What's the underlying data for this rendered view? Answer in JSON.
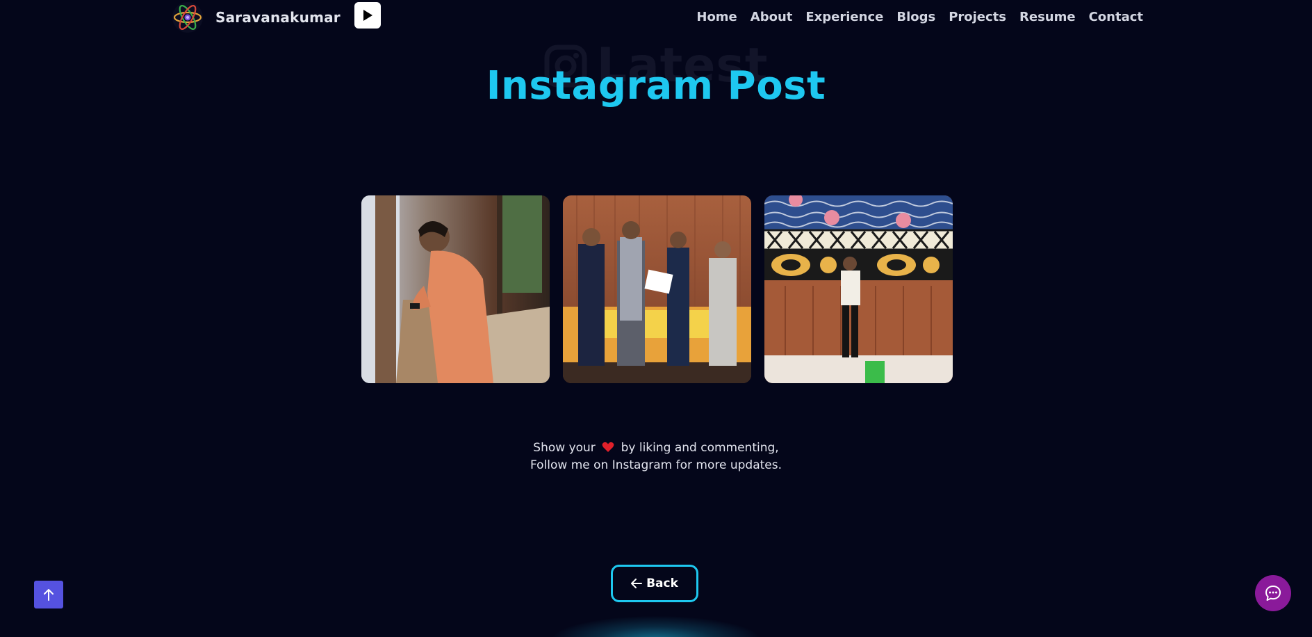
{
  "brand": {
    "name": "Saravanakumar",
    "logo_icon": "atom-icon",
    "play_icon": "play-icon"
  },
  "nav": {
    "items": [
      {
        "label": "Home"
      },
      {
        "label": "About"
      },
      {
        "label": "Experience"
      },
      {
        "label": "Blogs"
      },
      {
        "label": "Projects"
      },
      {
        "label": "Resume"
      },
      {
        "label": "Contact"
      }
    ]
  },
  "heading": {
    "ghost_text": "Latest",
    "ghost_icon": "instagram-icon",
    "title": "Instagram Post"
  },
  "gallery": {
    "posts": [
      {
        "name": "post-man-at-window"
      },
      {
        "name": "post-award-ceremony"
      },
      {
        "name": "post-man-at-mural"
      }
    ]
  },
  "caption": {
    "line1_before": "Show your",
    "line1_after": "by liking and commenting,",
    "line2": "Follow me on Instagram for more updates.",
    "heart_icon": "heart-icon"
  },
  "back_button": {
    "label": "Back",
    "icon": "arrow-left-icon"
  },
  "floating": {
    "scroll_top_icon": "arrow-up-icon",
    "chat_icon": "chat-bubble-icon"
  },
  "colors": {
    "background": "#04061a",
    "accent": "#1ec8f0",
    "scroll_top": "#5552e0",
    "chat": "#8a1a9a",
    "heart": "#e0202a"
  }
}
